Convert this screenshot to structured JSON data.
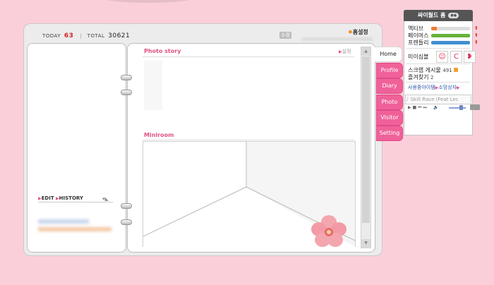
{
  "header": {
    "today_label": "TODAY",
    "today_count": "63",
    "total_label": "TOTAL",
    "total_count": "30621",
    "separator": "|",
    "edit_button": "수정",
    "home_settings": "홈설정"
  },
  "left_page": {
    "edit_link": "EDIT",
    "history_link": "HISTORY"
  },
  "right_page": {
    "photo_story_title": "Photo story",
    "setting_link": "설정",
    "miniroom_title": "Miniroom"
  },
  "tabs": [
    {
      "label": "Home",
      "active": true
    },
    {
      "label": "Profile",
      "active": false
    },
    {
      "label": "Diary",
      "active": false
    },
    {
      "label": "Photo",
      "active": false
    },
    {
      "label": "Visitor",
      "active": false
    },
    {
      "label": "Setting",
      "active": false
    }
  ],
  "side_panel": {
    "title": "싸이월드 홈",
    "stats": [
      {
        "label": "액티브",
        "fill_percent": 15,
        "color": "#f07a30"
      },
      {
        "label": "페이머스",
        "fill_percent": 100,
        "color": "#66b33a"
      },
      {
        "label": "프렌들리",
        "fill_percent": 100,
        "color": "#3f8fd0"
      }
    ],
    "mini_label": "미이심볼",
    "scrap_label": "스크랩 게시물",
    "scrap_count": "491",
    "favorites_label": "즐겨찾기",
    "favorites_count": "2",
    "items_link": "사용중아이템",
    "gift_link": "소망상자",
    "music_title": "Skill Race (Feat Lec"
  },
  "icons": {
    "sun": "sun-icon",
    "triangle": "triangle-right-icon",
    "arrow_up": "arrow-up-icon"
  }
}
